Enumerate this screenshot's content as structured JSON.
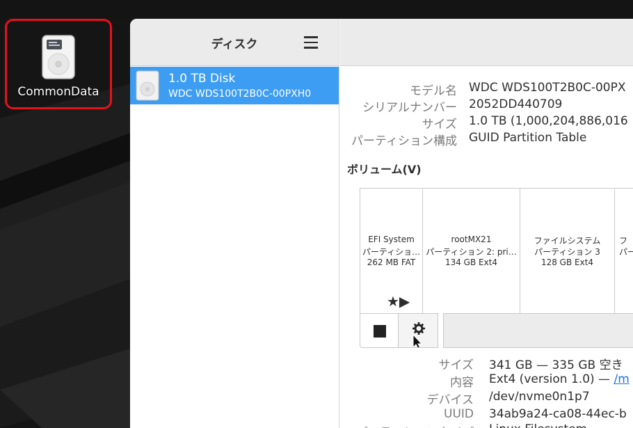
{
  "desktop": {
    "icon_label": "CommonData",
    "icon_name": "drive-harddisk-icon",
    "highlight_color": "#e8101c"
  },
  "window": {
    "sidebar_title": "ディスク",
    "menu_icon": "hamburger-menu-icon",
    "disk_item": {
      "title": "1.0 TB Disk",
      "subtitle": "WDC WDS100T2B0C-00PXH0",
      "selected_color": "#3d9df3"
    }
  },
  "disk_info": [
    {
      "label": "モデル名",
      "value": "WDC WDS100T2B0C-00PX"
    },
    {
      "label": "シリアルナンバー",
      "value": "2052DD440709"
    },
    {
      "label": "サイズ",
      "value": "1.0 TB (1,000,204,886,016"
    },
    {
      "label": "パーティション構成",
      "value": "GUID Partition Table"
    }
  ],
  "volumes": {
    "heading": "ボリューム(V)",
    "segments": [
      {
        "line1": "EFI System",
        "line2": "パーティショ…",
        "line3": "262 MB FAT"
      },
      {
        "line1": "rootMX21",
        "line2": "パーティション 2: pri…",
        "line3": "134 GB Ext4"
      },
      {
        "line1": "ファイルシステム",
        "line2": "パーティション 3",
        "line3": "128 GB Ext4"
      },
      {
        "line1": "フ",
        "line2": "パー",
        "line3": ""
      }
    ],
    "segment_flags": "★▶",
    "toolbar": {
      "stop_icon": "stop-icon",
      "settings_icon": "gear-icon"
    }
  },
  "partition_details": [
    {
      "label": "サイズ",
      "value": "341 GB — 335 GB 空き"
    },
    {
      "label": "内容",
      "value": "Ext4 (version 1.0) — ",
      "link": "/m"
    },
    {
      "label": "デバイス",
      "value": "/dev/nvme0n1p7"
    },
    {
      "label": "UUID",
      "value": "34ab9a24-ca08-44ec-b"
    },
    {
      "label": "パーティションタイプ",
      "value": "Linux Filesystem"
    }
  ]
}
